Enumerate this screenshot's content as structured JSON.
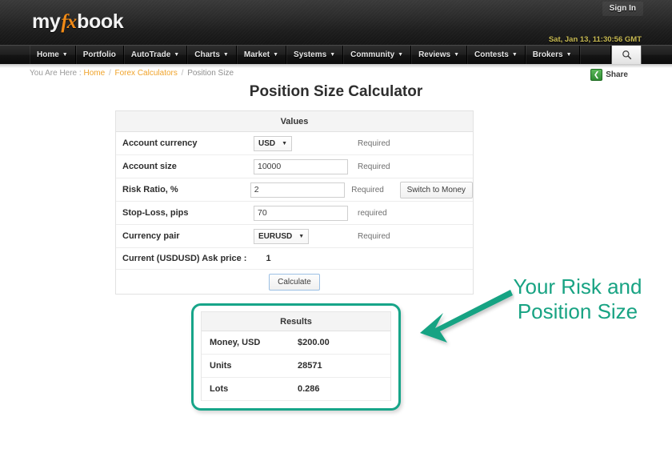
{
  "header": {
    "logo": {
      "part1": "my",
      "part2": "fx",
      "part3": "book"
    },
    "sign_in": "Sign In",
    "clock": "Sat, Jan 13, 11:30:56 GMT",
    "accent_orange": "#f08a17",
    "clock_color": "#c9bb53"
  },
  "nav": {
    "items": [
      {
        "label": "Home",
        "has_caret": true
      },
      {
        "label": "Portfolio",
        "has_caret": false
      },
      {
        "label": "AutoTrade",
        "has_caret": true
      },
      {
        "label": "Charts",
        "has_caret": true
      },
      {
        "label": "Market",
        "has_caret": true
      },
      {
        "label": "Systems",
        "has_caret": true
      },
      {
        "label": "Community",
        "has_caret": true
      },
      {
        "label": "Reviews",
        "has_caret": true
      },
      {
        "label": "Contests",
        "has_caret": true
      },
      {
        "label": "Brokers",
        "has_caret": true
      }
    ],
    "search_icon": "search-icon"
  },
  "breadcrumb": {
    "prefix": "You Are Here :",
    "home": "Home",
    "sep1": "/",
    "calculators": "Forex Calculators",
    "sep2": "/",
    "current": "Position Size"
  },
  "share": {
    "icon": "share-icon",
    "label": "Share"
  },
  "page": {
    "title": "Position Size Calculator"
  },
  "form": {
    "header": "Values",
    "rows": [
      {
        "label": "Account currency",
        "type": "select",
        "value": "USD",
        "required": "Required"
      },
      {
        "label": "Account size",
        "type": "text",
        "value": "10000",
        "required": "Required"
      },
      {
        "label": "Risk Ratio, %",
        "type": "text",
        "value": "2",
        "required": "Required",
        "button": "Switch to Money"
      },
      {
        "label": "Stop-Loss, pips",
        "type": "text",
        "value": "70",
        "required": "required"
      },
      {
        "label": "Currency pair",
        "type": "select",
        "value": "EURUSD",
        "required": "Required"
      }
    ],
    "ask_label": "Current (USDUSD) Ask price :",
    "ask_value": "1",
    "calculate_label": "Calculate"
  },
  "results": {
    "header": "Results",
    "highlight_color": "#17a589",
    "rows": [
      {
        "label": "Money, USD",
        "value": "$200.00"
      },
      {
        "label": "Units",
        "value": "28571"
      },
      {
        "label": "Lots",
        "value": "0.286"
      }
    ]
  },
  "annotation": {
    "line1": "Your Risk and",
    "line2": "Position Size",
    "color": "#18a383",
    "arrow": "arrow-left-icon"
  }
}
